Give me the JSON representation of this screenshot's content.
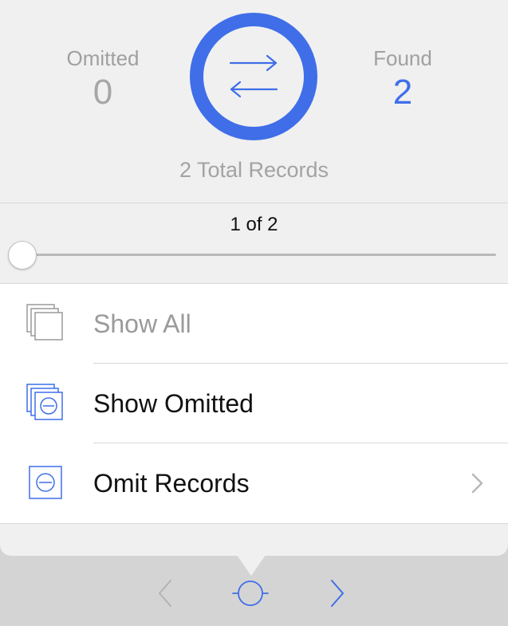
{
  "summary": {
    "omitted_label": "Omitted",
    "omitted_value": "0",
    "found_label": "Found",
    "found_value": "2",
    "total": "2 Total Records"
  },
  "pager": {
    "position": "1 of 2",
    "slider_fraction": 0.0
  },
  "menu": {
    "items": [
      {
        "label": "Show All",
        "icon": "stacked-records-icon",
        "enabled": false
      },
      {
        "label": "Show Omitted",
        "icon": "omitted-records-icon",
        "enabled": true
      },
      {
        "label": "Omit Records",
        "icon": "omit-record-icon",
        "enabled": true,
        "has_submenu": true
      }
    ]
  },
  "toolbar": {
    "buttons": [
      "previous-record-icon",
      "record-slider-icon",
      "next-record-icon"
    ]
  },
  "colors": {
    "accent": "#3f6ee8",
    "muted": "#a6a6a6",
    "toolbar_bg": "#d4d4d4",
    "panel_bg": "#f0f0f0"
  }
}
